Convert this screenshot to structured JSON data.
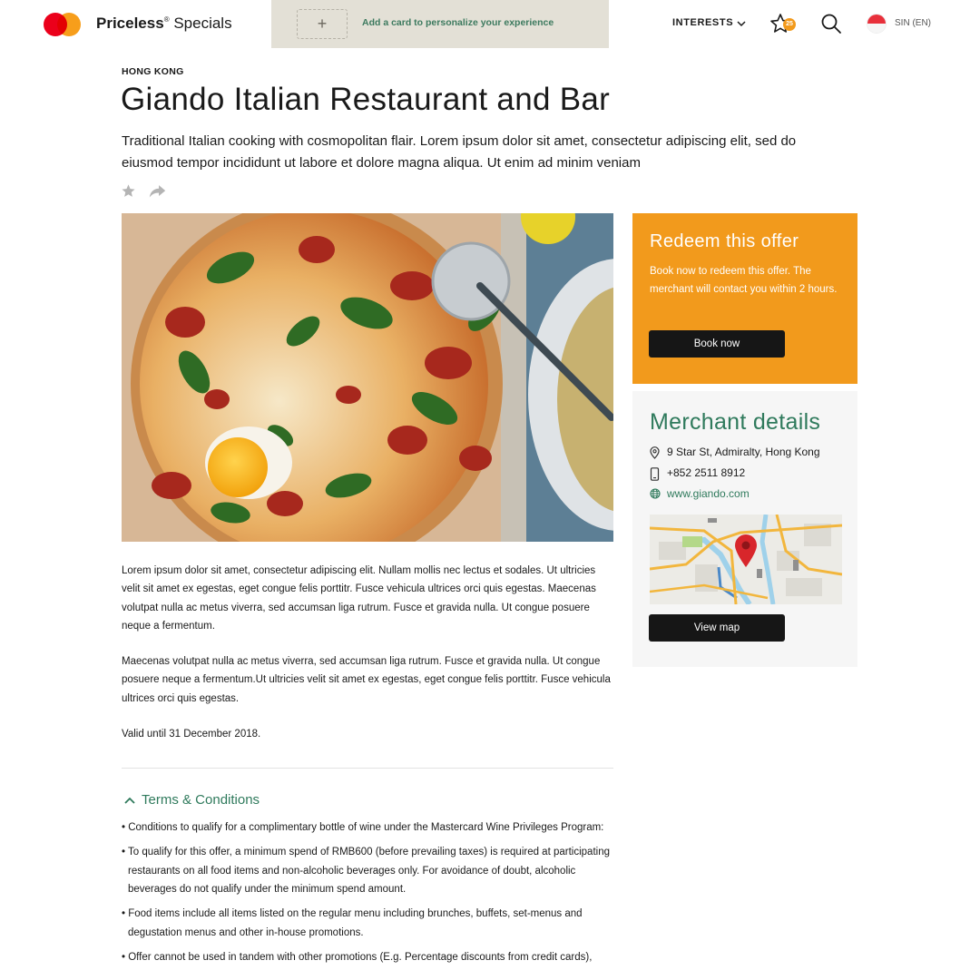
{
  "header": {
    "brand_bold": "Priceless",
    "brand_reg": "®",
    "brand_rest": " Specials",
    "add_card_plus": "+",
    "add_card_text": "Add a card to personalize your experience",
    "interests_label": "INTERESTS",
    "favorites_count": "25",
    "language_label": "SIN (EN)"
  },
  "offer": {
    "location": "HONG KONG",
    "title": "Giando Italian Restaurant and Bar",
    "subtitle": "Traditional Italian cooking with cosmopolitan flair. Lorem ipsum dolor sit amet, consectetur adipiscing elit, sed do eiusmod tempor incididunt ut labore et dolore magna aliqua. Ut enim ad minim veniam"
  },
  "description": {
    "paragraphs": [
      "Lorem ipsum dolor sit amet, consectetur adipiscing elit. Nullam mollis nec lectus et sodales. Ut ultricies velit sit amet ex egestas, eget congue felis porttitr. Fusce vehicula ultrices orci quis egestas. Maecenas volutpat nulla ac metus viverra, sed accumsan liga rutrum. Fusce et gravida nulla. Ut congue posuere neque a fermentum.",
      "Maecenas volutpat nulla ac metus viverra, sed accumsan liga rutrum. Fusce et gravida nulla. Ut congue posuere neque a fermentum.Ut ultricies velit sit amet ex egestas, eget congue felis porttitr. Fusce vehicula ultrices orci quis egestas.",
      "Valid until 31 December 2018."
    ]
  },
  "terms": {
    "heading": "Terms & Conditions",
    "items": [
      "Conditions to qualify for a complimentary bottle of wine under the Mastercard Wine Privileges Program:",
      "To qualify for this offer, a minimum spend of RMB600 (before prevailing taxes) is required at participating restaurants on all food items and non-alcoholic beverages only. For avoidance of doubt, alcoholic beverages do not qualify under the minimum spend amount.",
      "Food items include all items listed on the regular menu including brunches, buffets, set-menus and degustation menus and other in-house promotions.",
      "Offer cannot be used in tandem with other promotions (E.g. Percentage discounts from credit cards),"
    ]
  },
  "redeem": {
    "title": "Redeem this offer",
    "text": "Book now to redeem this offer. The merchant will contact you within 2 hours.",
    "button": "Book now"
  },
  "merchant": {
    "title": "Merchant details",
    "address": "9 Star St, Admiralty, Hong Kong",
    "phone": "+852 2511 8912",
    "website": "www.giando.com",
    "button": "View map"
  },
  "colors": {
    "orange": "#f29a1c",
    "green": "#2f7a5c",
    "dark_button": "#161616",
    "addcard_bg": "#e3e0d6",
    "panel_bg": "#f6f6f6"
  },
  "icons": [
    "mastercard-logo",
    "plus-icon",
    "chevron-down-icon",
    "star-icon",
    "search-icon",
    "singapore-flag-icon",
    "share-icon",
    "chevron-up-icon",
    "location-pin-icon",
    "phone-icon",
    "globe-icon",
    "map-pin-icon"
  ]
}
